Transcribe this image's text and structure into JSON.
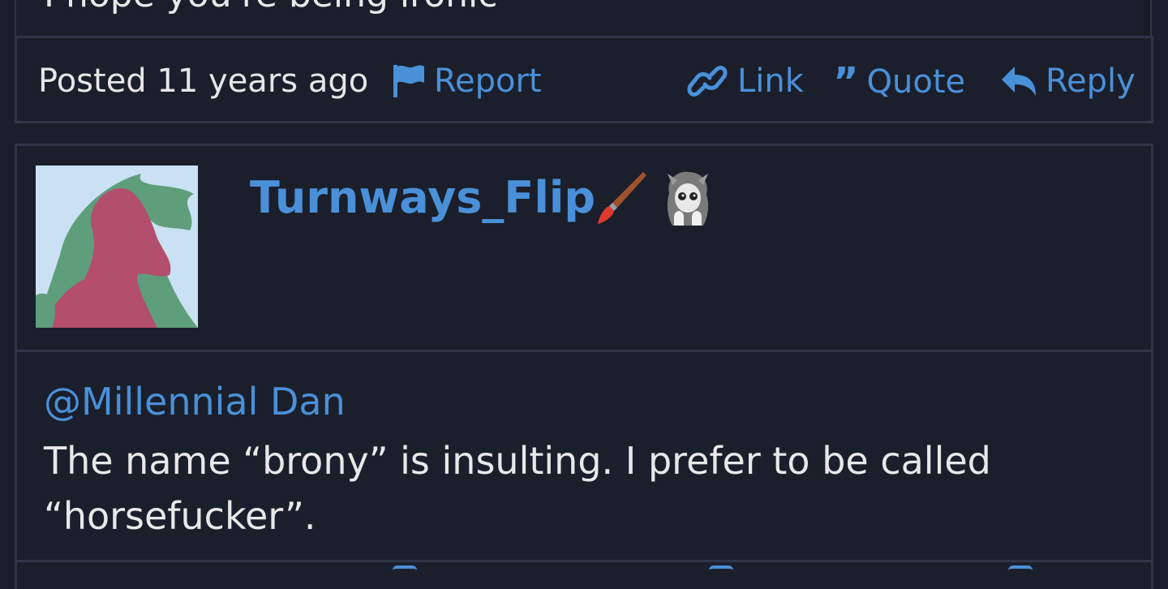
{
  "previous_post": {
    "body_text": "I hope you're being ironic",
    "footer": {
      "posted_label": "Posted 11 years ago",
      "report_label": "Report",
      "link_label": "Link",
      "quote_label": "Quote",
      "reply_label": "Reply"
    }
  },
  "post": {
    "username": "Turnways_Flip",
    "badges": [
      {
        "icon": "paintbrush-icon",
        "label": "Artist"
      },
      {
        "icon": "pony-badge-icon",
        "label": "Pony badge"
      }
    ],
    "mention": "@Millennial Dan",
    "body_line_1": "The name “brony” is insulting. I prefer to be called",
    "body_line_2": "“horsefucker”."
  },
  "colors": {
    "background": "#1a1f2b",
    "border": "#2e3548",
    "accent": "#4a90d9",
    "text": "#e8e8e8"
  }
}
